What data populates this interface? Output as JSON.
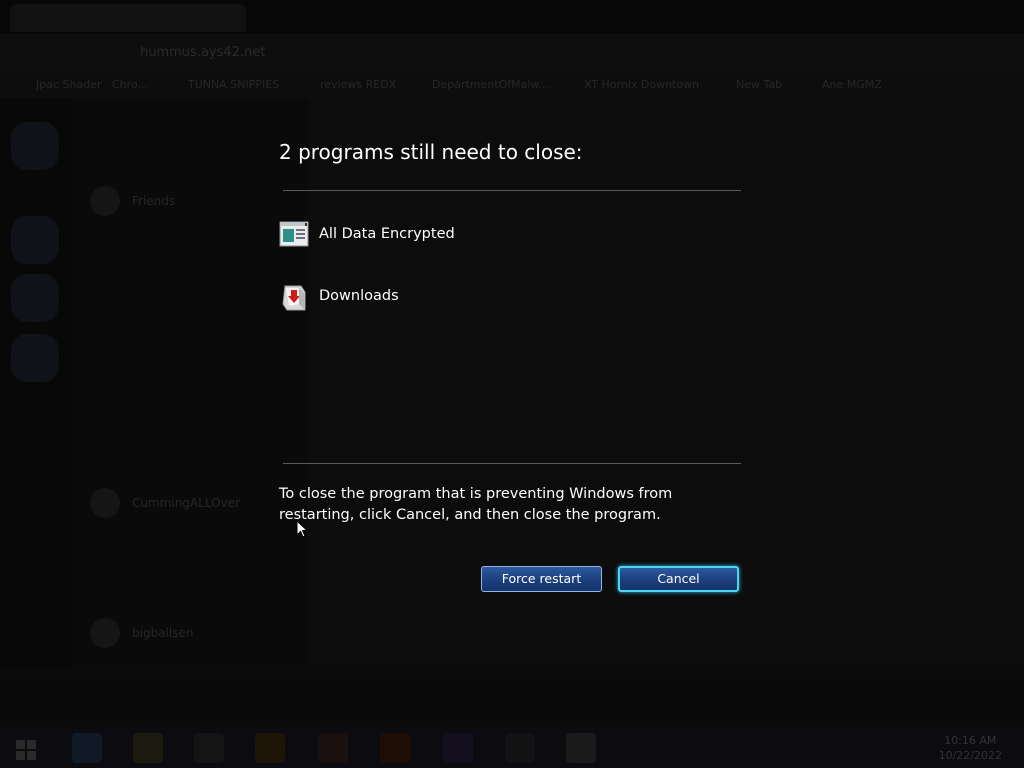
{
  "dialog": {
    "title": "2 programs still need to close:",
    "programs": [
      {
        "name": "All Data Encrypted",
        "icon": "document-window-icon"
      },
      {
        "name": "Downloads",
        "icon": "downloads-folder-icon"
      }
    ],
    "message": "To close the program that is preventing Windows from restarting, click Cancel, and then close the program.",
    "buttons": {
      "force_restart": "Force restart",
      "cancel": "Cancel"
    }
  },
  "background": {
    "url": "hummus.ays42.net",
    "bookmarks": [
      "Jpac Shader",
      "Chro...",
      "TUNNA SNIPPIES",
      "reviews REDX",
      "DepartmentOfMalw...",
      "XT Hornix Downtown",
      "New Tab",
      "Ane MGMZ"
    ],
    "friends_header": "Friends",
    "friend_names": [
      "CummingALLOver",
      "bigballsen"
    ],
    "clock": {
      "time": "10:16 AM",
      "date": "10/22/2022"
    }
  },
  "colors": {
    "button_fill": "#1c3f7c",
    "button_border": "#8fb4e8",
    "focus_ring": "#49d6f2",
    "separator": "#5a5a5a"
  }
}
